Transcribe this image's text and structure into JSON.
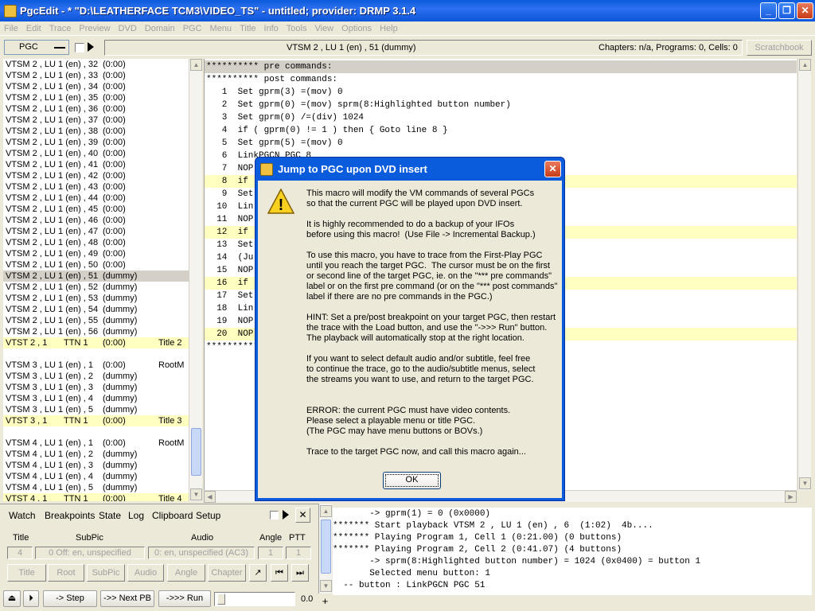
{
  "window": {
    "title": "PgcEdit - * \"D:\\LEATHERFACE TCM3\\VIDEO_TS\" - untitled; provider: DRMP 3.1.4",
    "min_glyph": "_",
    "max_glyph": "❐",
    "close_glyph": "✕"
  },
  "menu": [
    "File",
    "Edit",
    "Trace",
    "Preview",
    "DVD",
    "Domain",
    "PGC",
    "Menu",
    "Title",
    "Info",
    "Tools",
    "View",
    "Options",
    "Help"
  ],
  "toolbar": {
    "combo_value": "PGC",
    "current_pgc": "VTSM 2 , LU 1 (en) , 51  (dummy)",
    "chapters_info": "Chapters: n/a,  Programs: 0,  Cells: 0",
    "scratchbook_label": "Scratchbook"
  },
  "pgc_list": [
    {
      "name": "VTSM 2 , LU 1 (en) , 32",
      "info": "(0:00)",
      "extra": "",
      "style": ""
    },
    {
      "name": "VTSM 2 , LU 1 (en) , 33",
      "info": "(0:00)",
      "extra": "",
      "style": ""
    },
    {
      "name": "VTSM 2 , LU 1 (en) , 34",
      "info": "(0:00)",
      "extra": "",
      "style": ""
    },
    {
      "name": "VTSM 2 , LU 1 (en) , 35",
      "info": "(0:00)",
      "extra": "",
      "style": ""
    },
    {
      "name": "VTSM 2 , LU 1 (en) , 36",
      "info": "(0:00)",
      "extra": "",
      "style": ""
    },
    {
      "name": "VTSM 2 , LU 1 (en) , 37",
      "info": "(0:00)",
      "extra": "",
      "style": ""
    },
    {
      "name": "VTSM 2 , LU 1 (en) , 38",
      "info": "(0:00)",
      "extra": "",
      "style": ""
    },
    {
      "name": "VTSM 2 , LU 1 (en) , 39",
      "info": "(0:00)",
      "extra": "",
      "style": ""
    },
    {
      "name": "VTSM 2 , LU 1 (en) , 40",
      "info": "(0:00)",
      "extra": "",
      "style": ""
    },
    {
      "name": "VTSM 2 , LU 1 (en) , 41",
      "info": "(0:00)",
      "extra": "",
      "style": ""
    },
    {
      "name": "VTSM 2 , LU 1 (en) , 42",
      "info": "(0:00)",
      "extra": "",
      "style": ""
    },
    {
      "name": "VTSM 2 , LU 1 (en) , 43",
      "info": "(0:00)",
      "extra": "",
      "style": ""
    },
    {
      "name": "VTSM 2 , LU 1 (en) , 44",
      "info": "(0:00)",
      "extra": "",
      "style": ""
    },
    {
      "name": "VTSM 2 , LU 1 (en) , 45",
      "info": "(0:00)",
      "extra": "",
      "style": ""
    },
    {
      "name": "VTSM 2 , LU 1 (en) , 46",
      "info": "(0:00)",
      "extra": "",
      "style": ""
    },
    {
      "name": "VTSM 2 , LU 1 (en) , 47",
      "info": "(0:00)",
      "extra": "",
      "style": ""
    },
    {
      "name": "VTSM 2 , LU 1 (en) , 48",
      "info": "(0:00)",
      "extra": "",
      "style": ""
    },
    {
      "name": "VTSM 2 , LU 1 (en) , 49",
      "info": "(0:00)",
      "extra": "",
      "style": ""
    },
    {
      "name": "VTSM 2 , LU 1 (en) , 50",
      "info": "(0:00)",
      "extra": "",
      "style": ""
    },
    {
      "name": "VTSM 2 , LU 1 (en) , 51",
      "info": "(dummy)",
      "extra": "",
      "style": "sel"
    },
    {
      "name": "VTSM 2 , LU 1 (en) , 52",
      "info": "(dummy)",
      "extra": "",
      "style": ""
    },
    {
      "name": "VTSM 2 , LU 1 (en) , 53",
      "info": "(dummy)",
      "extra": "",
      "style": ""
    },
    {
      "name": "VTSM 2 , LU 1 (en) , 54",
      "info": "(dummy)",
      "extra": "",
      "style": ""
    },
    {
      "name": "VTSM 2 , LU 1 (en) , 55",
      "info": "(dummy)",
      "extra": "",
      "style": ""
    },
    {
      "name": "VTSM 2 , LU 1 (en) , 56",
      "info": "(dummy)",
      "extra": "",
      "style": ""
    },
    {
      "name": "VTST 2 , 1",
      "ttn": "TTN 1",
      "info": "(0:00)",
      "extra": "Title 2",
      "style": "hl"
    },
    {
      "name": "",
      "info": "",
      "extra": "",
      "style": ""
    },
    {
      "name": "VTSM 3 , LU 1 (en) , 1",
      "info": "(0:00)",
      "extra": "RootM",
      "style": ""
    },
    {
      "name": "VTSM 3 , LU 1 (en) , 2",
      "info": "(dummy)",
      "extra": "",
      "style": ""
    },
    {
      "name": "VTSM 3 , LU 1 (en) , 3",
      "info": "(dummy)",
      "extra": "",
      "style": ""
    },
    {
      "name": "VTSM 3 , LU 1 (en) , 4",
      "info": "(dummy)",
      "extra": "",
      "style": ""
    },
    {
      "name": "VTSM 3 , LU 1 (en) , 5",
      "info": "(dummy)",
      "extra": "",
      "style": ""
    },
    {
      "name": "VTST 3 , 1",
      "ttn": "TTN 1",
      "info": "(0:00)",
      "extra": "Title 3",
      "style": "hl"
    },
    {
      "name": "",
      "info": "",
      "extra": "",
      "style": ""
    },
    {
      "name": "VTSM 4 , LU 1 (en) , 1",
      "info": "(0:00)",
      "extra": "RootM",
      "style": ""
    },
    {
      "name": "VTSM 4 , LU 1 (en) , 2",
      "info": "(dummy)",
      "extra": "",
      "style": ""
    },
    {
      "name": "VTSM 4 , LU 1 (en) , 3",
      "info": "(dummy)",
      "extra": "",
      "style": ""
    },
    {
      "name": "VTSM 4 , LU 1 (en) , 4",
      "info": "(dummy)",
      "extra": "",
      "style": ""
    },
    {
      "name": "VTSM 4 , LU 1 (en) , 5",
      "info": "(dummy)",
      "extra": "",
      "style": ""
    },
    {
      "name": "VTST 4 , 1",
      "ttn": "TTN 1",
      "info": "(0:00)",
      "extra": "Title 4",
      "style": "hl"
    }
  ],
  "commands": [
    {
      "text": "********** pre commands:",
      "style": "head"
    },
    {
      "text": "********** post commands:",
      "style": ""
    },
    {
      "text": "   1  Set gprm(3) =(mov) 0",
      "style": ""
    },
    {
      "text": "   2  Set gprm(0) =(mov) sprm(8:Highlighted button number)",
      "style": ""
    },
    {
      "text": "   3  Set gprm(0) /=(div) 1024",
      "style": ""
    },
    {
      "text": "   4  if ( gprm(0) != 1 ) then { Goto line 8 }",
      "style": ""
    },
    {
      "text": "   5  Set gprm(5) =(mov) 0",
      "style": ""
    },
    {
      "text": "   6  LinkPGCN PGC 8",
      "style": ""
    },
    {
      "text": "   7  NOP",
      "style": ""
    },
    {
      "text": "   8  if",
      "style": "hl"
    },
    {
      "text": "   9  Set",
      "style": ""
    },
    {
      "text": "  10  Lin",
      "style": ""
    },
    {
      "text": "  11  NOP",
      "style": ""
    },
    {
      "text": "  12  if",
      "style": "hl"
    },
    {
      "text": "  13  Set",
      "style": ""
    },
    {
      "text": "  14  (Ju",
      "style": ""
    },
    {
      "text": "  15  NOP",
      "style": ""
    },
    {
      "text": "  16  if",
      "style": "hl"
    },
    {
      "text": "  17  Set",
      "style": ""
    },
    {
      "text": "  18  Lin",
      "style": ""
    },
    {
      "text": "  19  NOP",
      "style": ""
    },
    {
      "text": "  20  NOP",
      "style": "hl"
    },
    {
      "text": "**********",
      "style": ""
    }
  ],
  "dialog": {
    "title": "Jump to PGC upon DVD insert",
    "close_glyph": "✕",
    "warning_glyph": "!",
    "message": "This macro will modify the VM commands of several PGCs\nso that the current PGC will be played upon DVD insert.\n\nIt is highly recommended to do a backup of your IFOs\nbefore using this macro!  (Use File -> Incremental Backup.)\n\nTo use this macro, you have to trace from the First-Play PGC\nuntil you reach the target PGC.  The cursor must be on the first\nor second line of the target PGC, ie. on the \"*** pre commands\"\nlabel or on the first pre command (or on the \"*** post commands\"\nlabel if there are no pre commands in the PGC.)\n\nHINT: Set a pre/post breakpoint on your target PGC, then restart\nthe trace with the Load button, and use the \"->>> Run\" button.\nThe playback will automatically stop at the right location.\n\nIf you want to select default audio and/or subtitle, feel free\nto continue the trace, go to the audio/subtitle menus, select\nthe streams you want to use, and return to the target PGC.\n\n\nERROR: the current PGC must have video contents.\nPlease select a playable menu or title PGC.\n(The PGC may have menu buttons or BOVs.)\n\nTrace to the target PGC now, and call this macro again...",
    "ok_label": "OK"
  },
  "trace": {
    "tabs": [
      "Watch",
      "Breakpoints",
      "State",
      "Log",
      "Clipboard",
      "Setup"
    ],
    "headers": {
      "title": "Title",
      "subpic": "SubPic",
      "audio": "Audio",
      "angle": "Angle",
      "ptt": "PTT"
    },
    "values": {
      "title": "4",
      "subpic": "0 Off: en, unspecified",
      "audio": "0: en, unspecified (AC3)",
      "angle": "1",
      "ptt": "1"
    },
    "jump_buttons": [
      "Title",
      "Root",
      "SubPic",
      "Audio",
      "Angle",
      "Chapter"
    ],
    "step_label": "-> Step",
    "nextpb_label": "->> Next PB",
    "run_label": "->>> Run",
    "speed_value": "0.0",
    "plus_label": "+"
  },
  "log": [
    "       -> gprm(1) = 0 (0x0000)",
    "******* Start playback VTSM 2 , LU 1 (en) , 6  (1:02)  4b....",
    "******* Playing Program 1, Cell 1 (0:21.00) (0 buttons)",
    "******* Playing Program 2, Cell 2 (0:41.07) (4 buttons)",
    "       -> sprm(8:Highlighted button number) = 1024 (0x0400) = button 1",
    "       Selected menu button: 1",
    "  -- button : LinkPGCN PGC 51"
  ]
}
